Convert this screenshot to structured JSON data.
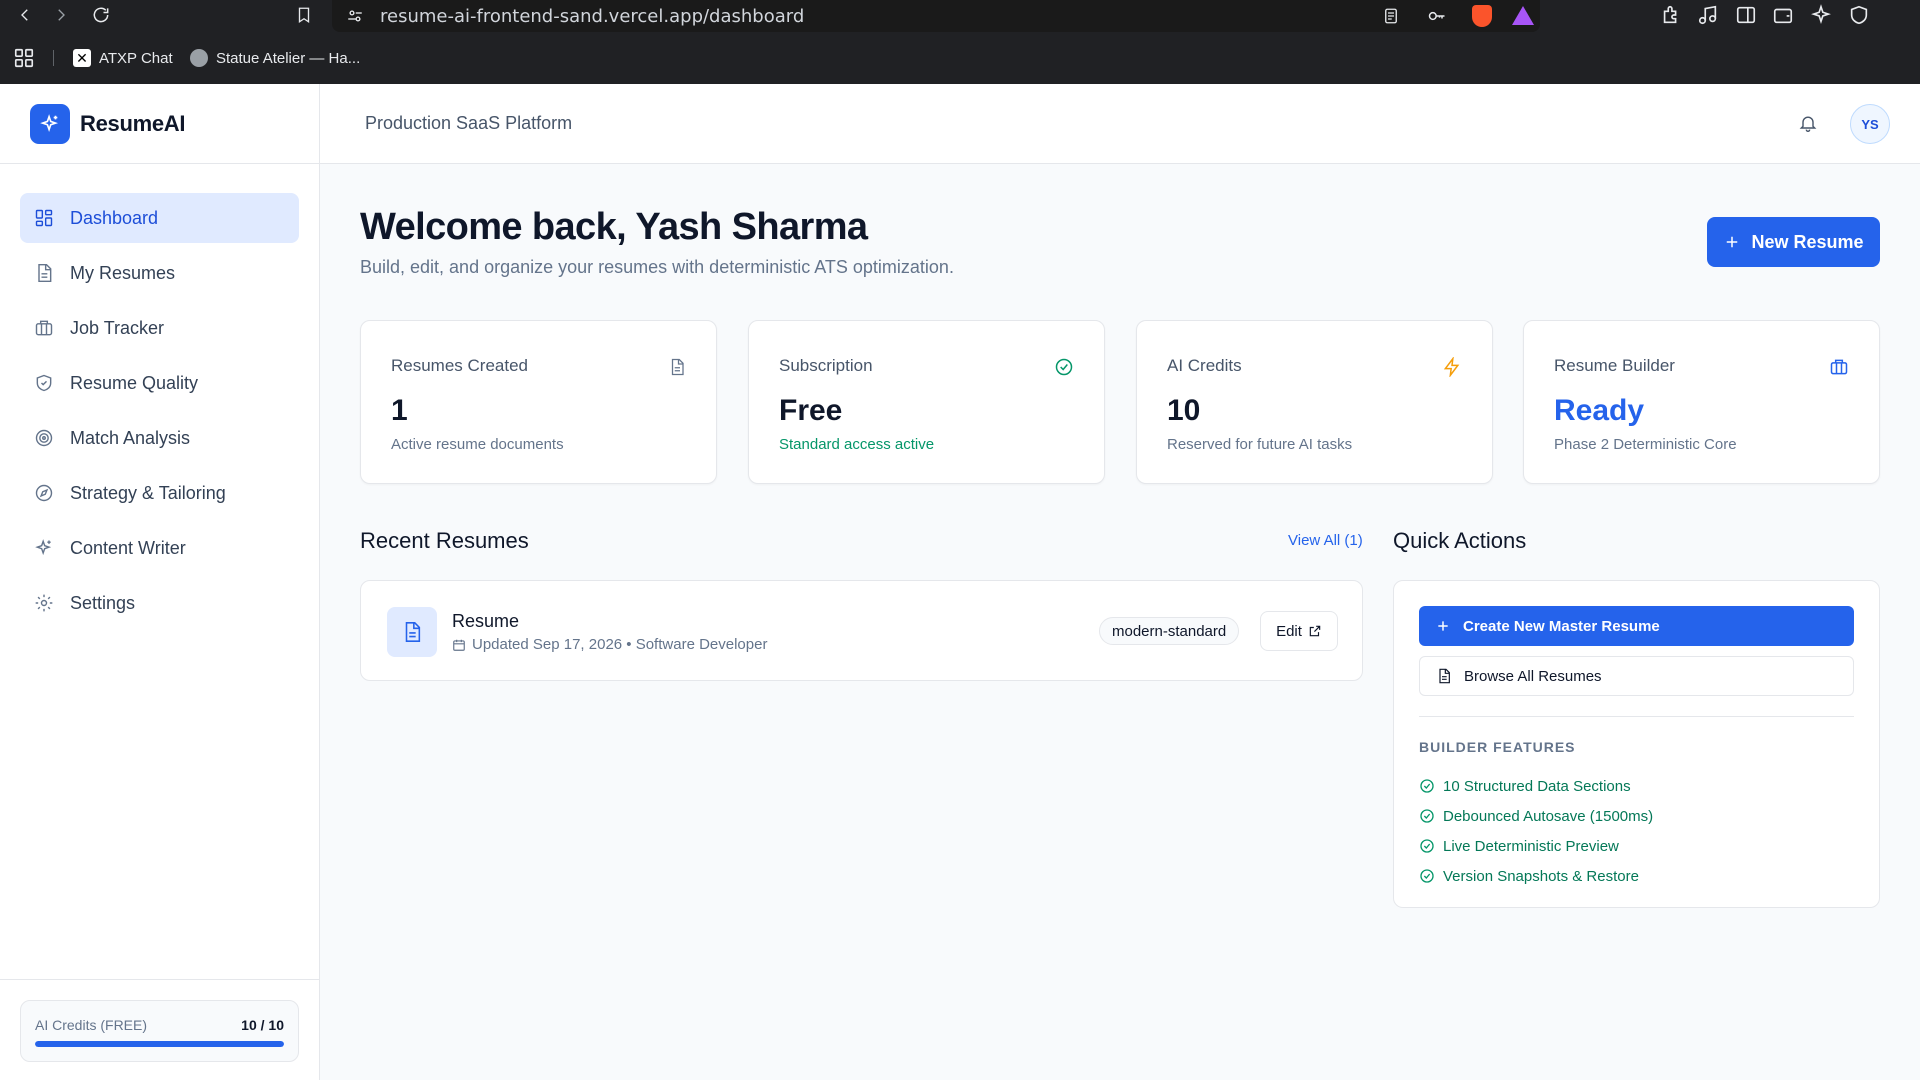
{
  "browser": {
    "url": "resume-ai-frontend-sand.vercel.app/dashboard",
    "bookmarks": [
      "ATXP Chat",
      "Statue Atelier — Ha..."
    ]
  },
  "app": {
    "brand": "ResumeAI",
    "header_title": "Production SaaS Platform",
    "avatar_initials": "YS",
    "accent_color": "#2563eb"
  },
  "sidebar": {
    "items": [
      {
        "label": "Dashboard",
        "icon": "grid-icon",
        "active": true
      },
      {
        "label": "My Resumes",
        "icon": "document-icon"
      },
      {
        "label": "Job Tracker",
        "icon": "briefcase-icon"
      },
      {
        "label": "Resume Quality",
        "icon": "shield-icon"
      },
      {
        "label": "Match Analysis",
        "icon": "target-icon"
      },
      {
        "label": "Strategy & Tailoring",
        "icon": "compass-icon"
      },
      {
        "label": "Content Writer",
        "icon": "sparkles-icon"
      },
      {
        "label": "Settings",
        "icon": "gear-icon"
      }
    ],
    "credits": {
      "label": "AI Credits (FREE)",
      "value": "10 / 10",
      "fraction": 1.0
    }
  },
  "main": {
    "welcome": "Welcome back, Yash Sharma",
    "subtitle": "Build, edit, and organize your resumes with deterministic ATS optimization.",
    "new_resume_label": "New Resume",
    "stats": [
      {
        "label": "Resumes Created",
        "value": "1",
        "sub": "Active resume documents",
        "icon": "document-icon"
      },
      {
        "label": "Subscription",
        "value": "Free",
        "sub": "Standard access active",
        "icon": "check-circle-icon"
      },
      {
        "label": "AI Credits",
        "value": "10",
        "sub": "Reserved for future AI tasks",
        "icon": "lightning-icon"
      },
      {
        "label": "Resume Builder",
        "value": "Ready",
        "sub": "Phase 2 Deterministic Core",
        "icon": "briefcase-icon"
      }
    ],
    "recent": {
      "title": "Recent Resumes",
      "view_all": "View All (1)",
      "items": [
        {
          "name": "Resume",
          "meta": "Updated Sep 17, 2026 • Software Developer",
          "template": "modern-standard",
          "edit_label": "Edit"
        }
      ]
    },
    "quick_actions": {
      "title": "Quick Actions",
      "create_label": "Create New Master Resume",
      "browse_label": "Browse All Resumes",
      "features_heading": "BUILDER FEATURES",
      "features": [
        "10 Structured Data Sections",
        "Debounced Autosave (1500ms)",
        "Live Deterministic Preview",
        "Version Snapshots & Restore"
      ]
    }
  }
}
